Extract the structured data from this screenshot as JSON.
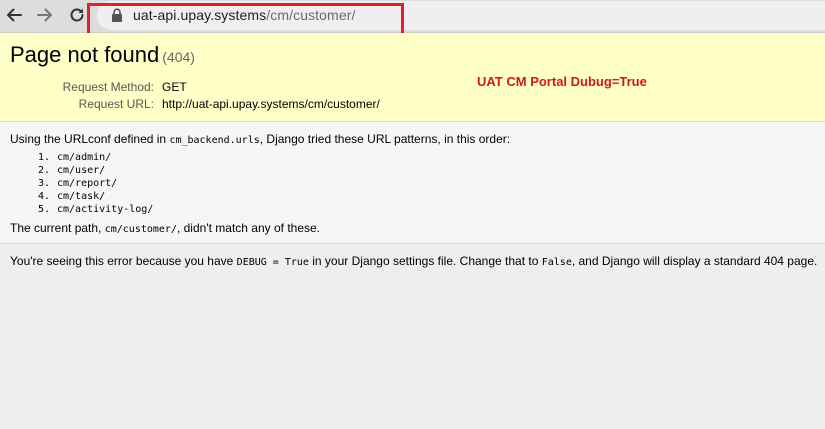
{
  "browser": {
    "url_host": "uat-api.upay.systems",
    "url_path": "/cm/customer/",
    "icons": {
      "back": "arrow-left-icon",
      "forward": "arrow-right-icon",
      "reload": "reload-icon",
      "lock": "lock-icon"
    },
    "highlight_color": "#e4212b"
  },
  "summary": {
    "title": "Page not found",
    "status": "(404)",
    "request_method_label": "Request Method:",
    "request_method": "GET",
    "request_url_label": "Request URL:",
    "request_url": "http://uat-api.upay.systems/cm/customer/",
    "background": "#ffffc8"
  },
  "annotation": {
    "text": "UAT CM Portal Dubug=True",
    "color": "#cc1a1a"
  },
  "info": {
    "intro_before": "Using the URLconf defined in ",
    "urlconf": "cm_backend.urls",
    "intro_after": ", Django tried these URL patterns, in this order:",
    "patterns": [
      {
        "num": "1.",
        "pattern": "cm/admin/"
      },
      {
        "num": "2.",
        "pattern": "cm/user/"
      },
      {
        "num": "3.",
        "pattern": "cm/report/"
      },
      {
        "num": "4.",
        "pattern": "cm/task/"
      },
      {
        "num": "5.",
        "pattern": "cm/activity-log/"
      }
    ],
    "current_before": "The current path, ",
    "current_path": "cm/customer/",
    "current_after": ", didn't match any of these."
  },
  "explanation": {
    "before_debug": "You're seeing this error because you have ",
    "debug_setting": "DEBUG = True",
    "middle": " in your Django settings file. Change that to ",
    "false_value": "False",
    "after": ", and Django will display a standard 404 page."
  }
}
